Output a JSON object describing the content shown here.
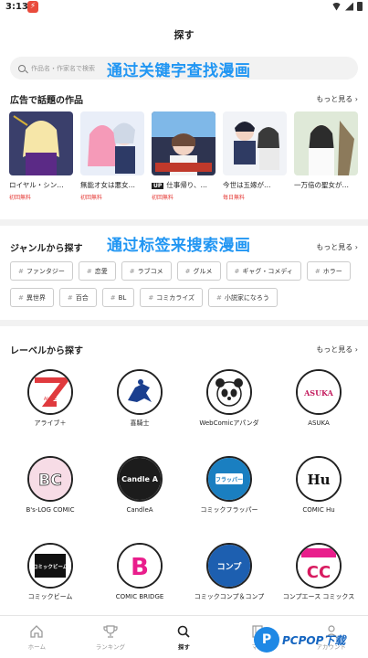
{
  "status": {
    "time": "3:13"
  },
  "header": {
    "title": "探す"
  },
  "search": {
    "placeholder": "作品名・作家名で検索"
  },
  "captions": {
    "search_caption": "通过关键字查找漫画",
    "tag_caption": "通过标签来搜索漫画"
  },
  "ads": {
    "title": "広告で話題の作品",
    "more": "もっと見る ›",
    "items": [
      {
        "name": "ロイヤル・シン…",
        "tag": "初回無料",
        "up": ""
      },
      {
        "name": "無能オ女は悪女…",
        "tag": "初回無料",
        "up": ""
      },
      {
        "name": "仕事帰り、…",
        "tag": "初回無料",
        "up": "UP"
      },
      {
        "name": "今世は五嫁が…",
        "tag": "毎日無料",
        "up": ""
      },
      {
        "name": "一万倍の聖女が…",
        "tag": "",
        "up": ""
      }
    ]
  },
  "genres": {
    "title": "ジャンルから探す",
    "more": "もっと見る ›",
    "hash": "#",
    "items": [
      "ファンタジー",
      "恋愛",
      "ラブコメ",
      "グルメ",
      "ギャグ・コメディ",
      "ホラー",
      "異世界",
      "百合",
      "BL",
      "コミカライズ",
      "小説家になろう"
    ]
  },
  "labels": {
    "title": "レーベルから探す",
    "more": "もっと見る ›",
    "items": [
      {
        "name": "アライブ＋",
        "logo_text": "ALIVE"
      },
      {
        "name": "喜騎士",
        "logo_text": ""
      },
      {
        "name": "WebComicアパンダ",
        "logo_text": ""
      },
      {
        "name": "ASUKA",
        "logo_text": "ASUKA"
      },
      {
        "name": "B's-LOG COMIC",
        "logo_text": "BC"
      },
      {
        "name": "CandleA",
        "logo_text": "Candle A"
      },
      {
        "name": "コミックフラッパー",
        "logo_text": "フラッパー"
      },
      {
        "name": "COMIC Hu",
        "logo_text": "Hu"
      },
      {
        "name": "コミックビーム",
        "logo_text": "コミックビーム"
      },
      {
        "name": "COMIC BRIDGE",
        "logo_text": "B"
      },
      {
        "name": "コミックコンプ＆コンプ",
        "logo_text": "コンプ"
      },
      {
        "name": "コンプエース コミックス",
        "logo_text": "CC"
      }
    ]
  },
  "bottom_nav": [
    {
      "label": "ホーム",
      "icon": "home-icon"
    },
    {
      "label": "ランキング",
      "icon": "trophy-icon"
    },
    {
      "label": "探す",
      "icon": "search-icon"
    },
    {
      "label": "マイ",
      "icon": "book-icon"
    },
    {
      "label": "アカウント",
      "icon": "person-icon"
    }
  ],
  "watermark": {
    "logo": "P",
    "text": "PCPOP下载"
  },
  "colors": {
    "accent": "#2196f3",
    "free_tag": "#e53935",
    "divider": "#f2f2f2"
  }
}
